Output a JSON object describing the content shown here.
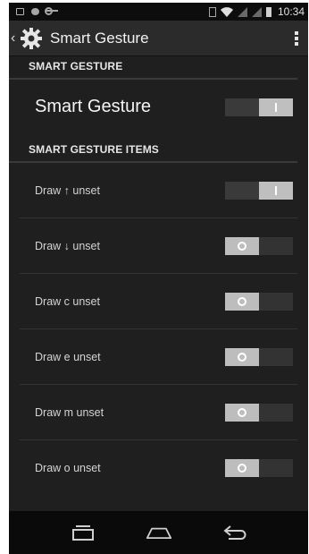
{
  "status_bar": {
    "time": "10:34"
  },
  "action_bar": {
    "back": "‹",
    "title": "Smart Gesture"
  },
  "sections": [
    {
      "header": "SMART GESTURE"
    },
    {
      "header": "SMART GESTURE ITEMS"
    }
  ],
  "main_setting": {
    "label": "Smart Gesture",
    "state": "on"
  },
  "items": [
    {
      "label": "Draw ↑ unset",
      "state": "on"
    },
    {
      "label": "Draw ↓ unset",
      "state": "off"
    },
    {
      "label": "Draw c unset",
      "state": "off"
    },
    {
      "label": "Draw e unset",
      "state": "off"
    },
    {
      "label": "Draw m unset",
      "state": "off"
    },
    {
      "label": "Draw o unset",
      "state": "off"
    }
  ],
  "icons": {
    "back": "chevron-left-icon",
    "app": "gear-icon",
    "overflow": "overflow-menu-icon",
    "recents": "recent-apps-icon",
    "home": "home-icon",
    "back_nav": "back-arrow-icon"
  },
  "colors": {
    "background": "#1f1f1f",
    "toggle_on": "#bfbfbf",
    "toggle_off": "#bdbdbd"
  }
}
